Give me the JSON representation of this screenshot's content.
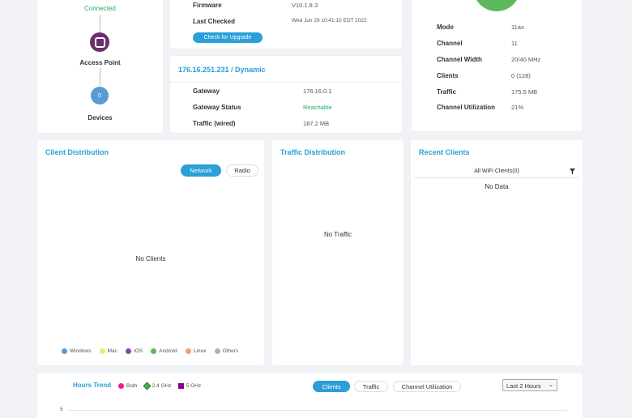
{
  "topology": {
    "connected_label": "Connected",
    "access_point_label": "Access Point",
    "devices_label": "Devices",
    "devices_count": "0"
  },
  "firmware": {
    "firmware_label": "Firmware",
    "firmware_value": "V10.1.8.3",
    "last_checked_label": "Last Checked",
    "last_checked_value": "Wed Jun 29 10:41:10 EDT 2022",
    "upgrade_button": "Check for Upgrade"
  },
  "wan": {
    "title": "176.16.251.231 / Dynamic",
    "gateway_label": "Gateway",
    "gateway_value": "176.16.0.1",
    "gateway_status_label": "Gateway Status",
    "gateway_status_value": "Reachable",
    "traffic_label": "Traffic (wired)",
    "traffic_value": "187.2 MB"
  },
  "radio": {
    "mode_label": "Mode",
    "mode_value": "11ax",
    "channel_label": "Channel",
    "channel_value": "11",
    "width_label": "Channel Width",
    "width_value": "20/40 MHz",
    "clients_label": "Clients",
    "clients_value": "0 (128)",
    "traffic_label": "Traffic",
    "traffic_value": "175.5 MB",
    "util_label": "Channel Utilization",
    "util_value": "21%",
    "status_color": "#5cb85c"
  },
  "client_distribution": {
    "title": "Client Distribution",
    "tab_network": "Network",
    "tab_radio": "Radio",
    "empty": "No Clients",
    "legend": [
      {
        "label": "Windows",
        "color": "#5b9bd5"
      },
      {
        "label": "Mac",
        "color": "#e8f06a"
      },
      {
        "label": "iOS",
        "color": "#8e44ad"
      },
      {
        "label": "Android",
        "color": "#5cb85c"
      },
      {
        "label": "Linux",
        "color": "#f0a070"
      },
      {
        "label": "Others",
        "color": "#b0b0b0"
      }
    ]
  },
  "traffic_distribution": {
    "title": "Traffic Distribution",
    "empty": "No Traffic"
  },
  "recent_clients": {
    "title": "Recent Clients",
    "filter_label": "All WiFi Clients(0)",
    "empty": "No Data"
  },
  "hours_trend": {
    "title": "Hours Trend",
    "legend": [
      {
        "label": "Both",
        "color": "#e91e8c"
      },
      {
        "label": "2.4 GHz",
        "color": "#4caf50"
      },
      {
        "label": "5 GHz",
        "color": "#8b008b"
      }
    ],
    "tab_clients": "Clients",
    "tab_traffic": "Traffic",
    "tab_util": "Channel Utilization",
    "range_select": "Last 2 Hours",
    "y_tick": "5"
  }
}
